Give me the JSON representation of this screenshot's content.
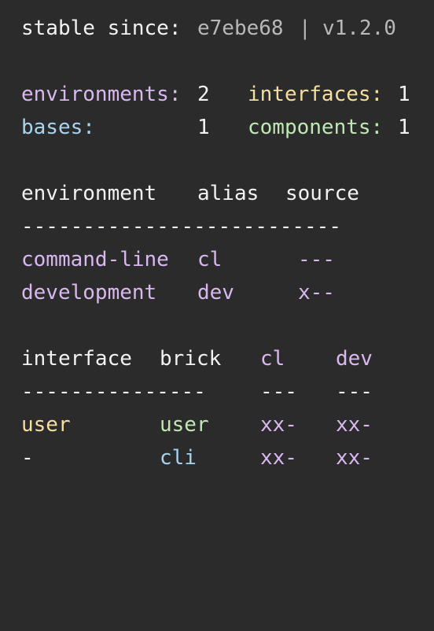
{
  "status": {
    "label": "stable since:",
    "commit": "e7ebe68",
    "separator": "|",
    "version": "v1.2.0"
  },
  "summary": {
    "environments_label": "environments:",
    "environments_value": "2",
    "interfaces_label": "interfaces:",
    "interfaces_value": "1",
    "bases_label": "bases:",
    "bases_value": "1",
    "components_label": "components:",
    "components_value": "1"
  },
  "env_table": {
    "headers": [
      "environment",
      "alias",
      "source"
    ],
    "divider": "--------------------------",
    "rows": [
      {
        "name": "command-line",
        "alias": "cl",
        "source": "---"
      },
      {
        "name": "development",
        "alias": "dev",
        "source": "x--"
      }
    ]
  },
  "brick_table": {
    "headers": [
      "interface",
      "brick",
      "cl",
      "dev"
    ],
    "dividers": [
      "---------------",
      "---",
      "---"
    ],
    "rows": [
      {
        "interface": "user",
        "brick": "user",
        "cl": "xx-",
        "dev": "xx-"
      },
      {
        "interface": "-",
        "brick": "cli",
        "cl": "xx-",
        "dev": "xx-"
      }
    ]
  },
  "colors": {
    "background": "#2b2b2b",
    "text": "#f2f2f2",
    "muted": "#b8b8b8",
    "environment": "#d9b8f0",
    "base": "#a9d4ef",
    "interface": "#f5dfa0",
    "component": "#bfe8b4"
  }
}
